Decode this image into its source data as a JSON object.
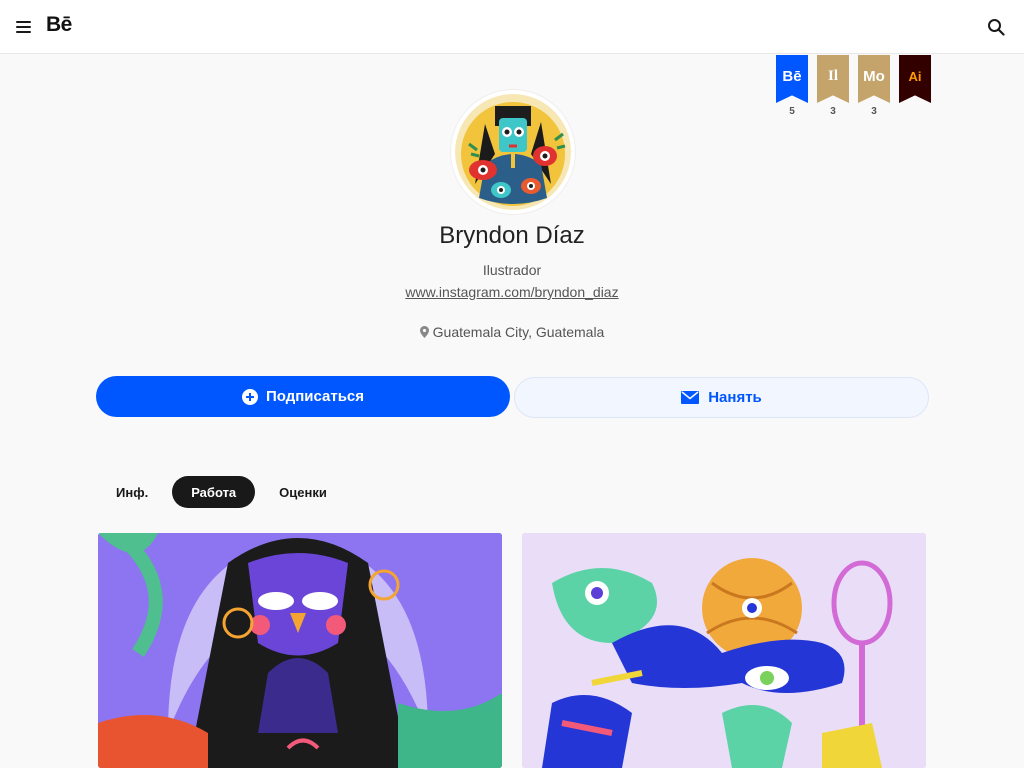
{
  "header": {
    "logo_text": "Bē",
    "menu_icon": "hamburger-menu-icon",
    "search_icon": "search-icon"
  },
  "badges": [
    {
      "label": "Bē",
      "count": "5",
      "color": "#0057ff",
      "text_color": "#ffffff"
    },
    {
      "label": "Il",
      "count": "3",
      "color": "#c4a46b",
      "text_color": "#ffffff"
    },
    {
      "label": "Mo",
      "count": "3",
      "color": "#c4a46b",
      "text_color": "#ffffff"
    },
    {
      "label": "Ai",
      "count": "",
      "color": "#330000",
      "text_color": "#ff9a00"
    }
  ],
  "profile": {
    "name": "Bryndon Díaz",
    "occupation": "Ilustrador",
    "website": "www.instagram.com/bryndon_diaz",
    "location": "Guatemala City, Guatemala"
  },
  "actions": {
    "follow_label": "Подписаться",
    "hire_label": "Нанять"
  },
  "tabs": [
    {
      "label": "Инф.",
      "active": false
    },
    {
      "label": "Работа",
      "active": true
    },
    {
      "label": "Оценки",
      "active": false
    }
  ],
  "colors": {
    "accent": "#0057ff",
    "tab_active_bg": "#191919"
  }
}
